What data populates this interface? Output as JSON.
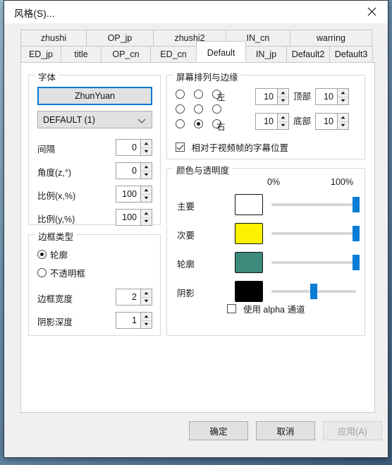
{
  "window": {
    "title": "风格(S)...",
    "close_icon": "close-icon"
  },
  "tabs": {
    "row1": [
      {
        "label": "zhushi",
        "active": false,
        "width": 94
      },
      {
        "label": "OP_jp",
        "active": false,
        "width": 96
      },
      {
        "label": "zhushi2",
        "active": false,
        "width": 104
      },
      {
        "label": "IN_cn",
        "active": false,
        "width": 92
      },
      {
        "label": "warring",
        "active": false,
        "width": 117
      }
    ],
    "row2": [
      {
        "label": "ED_jp",
        "active": false,
        "width": 58
      },
      {
        "label": "title",
        "active": false,
        "width": 58
      },
      {
        "label": "OP_cn",
        "active": false,
        "width": 71
      },
      {
        "label": "ED_cn",
        "active": false,
        "width": 66
      },
      {
        "label": "Default",
        "active": true,
        "width": 71
      },
      {
        "label": "IN_jp",
        "active": false,
        "width": 59
      },
      {
        "label": "Default2",
        "active": false,
        "width": 62
      },
      {
        "label": "Default3",
        "active": false,
        "width": 62
      }
    ]
  },
  "font_group": {
    "legend": "字体",
    "font_name": "ZhunYuan",
    "charset": "DEFAULT (1)",
    "chevron_icon": "chevron-down-icon",
    "fields": [
      {
        "label": "间隔",
        "value": "0"
      },
      {
        "label": "角度(z,°)",
        "value": "0"
      },
      {
        "label": "比例(x,%)",
        "value": "100"
      },
      {
        "label": "比例(y,%)",
        "value": "100"
      }
    ]
  },
  "border_group": {
    "legend": "边框类型",
    "radios": [
      {
        "label": "轮廓",
        "selected": true
      },
      {
        "label": "不透明框",
        "selected": false
      }
    ],
    "fields": [
      {
        "label": "边框宽度",
        "value": "2"
      },
      {
        "label": "阴影深度",
        "value": "1"
      }
    ]
  },
  "screen_group": {
    "legend": "屏幕排列与边缘",
    "align_label_left": "左",
    "align_label_right": "右",
    "align_grid": [
      [
        false,
        false,
        false
      ],
      [
        false,
        false,
        false
      ],
      [
        false,
        true,
        false
      ]
    ],
    "margins": [
      {
        "value": "10",
        "label": "顶部",
        "value2": "10"
      },
      {
        "value": "10",
        "label": "底部",
        "value2": "10"
      }
    ],
    "relative_checkbox": {
      "label": "相对于视频帧的字幕位置",
      "checked": true
    }
  },
  "colors_group": {
    "legend": "颜色与透明度",
    "scale_min": "0%",
    "scale_max": "100%",
    "rows": [
      {
        "label": "主要",
        "color": "#FFFFFF",
        "alpha_pct": 100
      },
      {
        "label": "次要",
        "color": "#FFF200",
        "alpha_pct": 100
      },
      {
        "label": "轮廓",
        "color": "#3C8A7C",
        "alpha_pct": 100
      },
      {
        "label": "阴影",
        "color": "#000000",
        "alpha_pct": 50
      }
    ],
    "alpha_checkbox": {
      "label": "使用 alpha 通道",
      "checked": false
    }
  },
  "footer": {
    "ok": "确定",
    "cancel": "取消",
    "apply": "应用(A)",
    "apply_disabled": true
  },
  "theme": {
    "accent": "#0078D7",
    "slider_thumb": "#0A7CD4",
    "window_bg": "#F0F0F0",
    "page_bg": "#FFFFFF"
  }
}
